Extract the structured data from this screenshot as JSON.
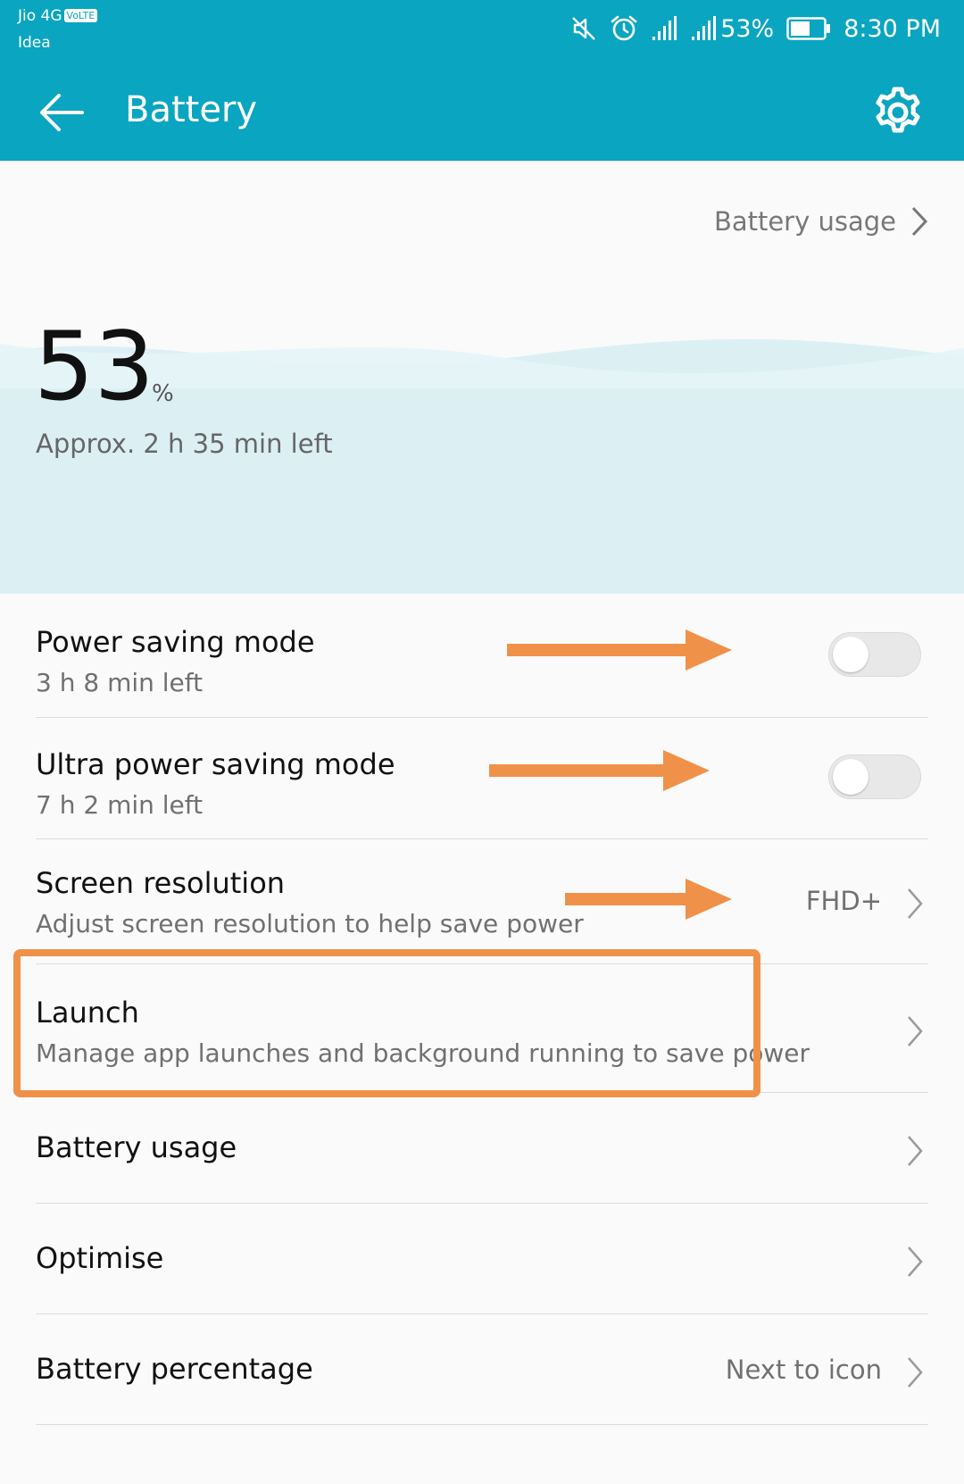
{
  "status_bar": {
    "carrier_primary": "Jio 4G",
    "volte_badge": "VoLTE",
    "carrier_secondary": "Idea",
    "battery_percent": "53%",
    "time": "8:30 PM",
    "icons": [
      "mute-icon",
      "alarm-icon",
      "signal-icon",
      "signal-icon",
      "battery-icon"
    ]
  },
  "app_bar": {
    "title": "Battery",
    "back_icon": "arrow-left-icon",
    "settings_icon": "gear-icon"
  },
  "header": {
    "usage_link": "Battery usage",
    "percent_value": "53",
    "percent_unit": "%",
    "time_left": "Approx. 2 h 35 min left"
  },
  "settings": {
    "power_saving": {
      "title": "Power saving mode",
      "subtitle": "3 h 8 min left",
      "enabled": false
    },
    "ultra_power_saving": {
      "title": "Ultra power saving mode",
      "subtitle": "7 h 2 min left",
      "enabled": false
    },
    "screen_resolution": {
      "title": "Screen resolution",
      "subtitle": "Adjust screen resolution to help save power",
      "value": "FHD+"
    },
    "launch": {
      "title": "Launch",
      "subtitle": "Manage app launches and background running to save power"
    },
    "battery_usage": {
      "title": "Battery usage"
    },
    "optimise": {
      "title": "Optimise"
    },
    "battery_percentage": {
      "title": "Battery percentage",
      "value": "Next to icon"
    }
  },
  "colors": {
    "accent": "#0aa5c0",
    "annotation": "#f0914a",
    "wave": "#d6eef3"
  }
}
